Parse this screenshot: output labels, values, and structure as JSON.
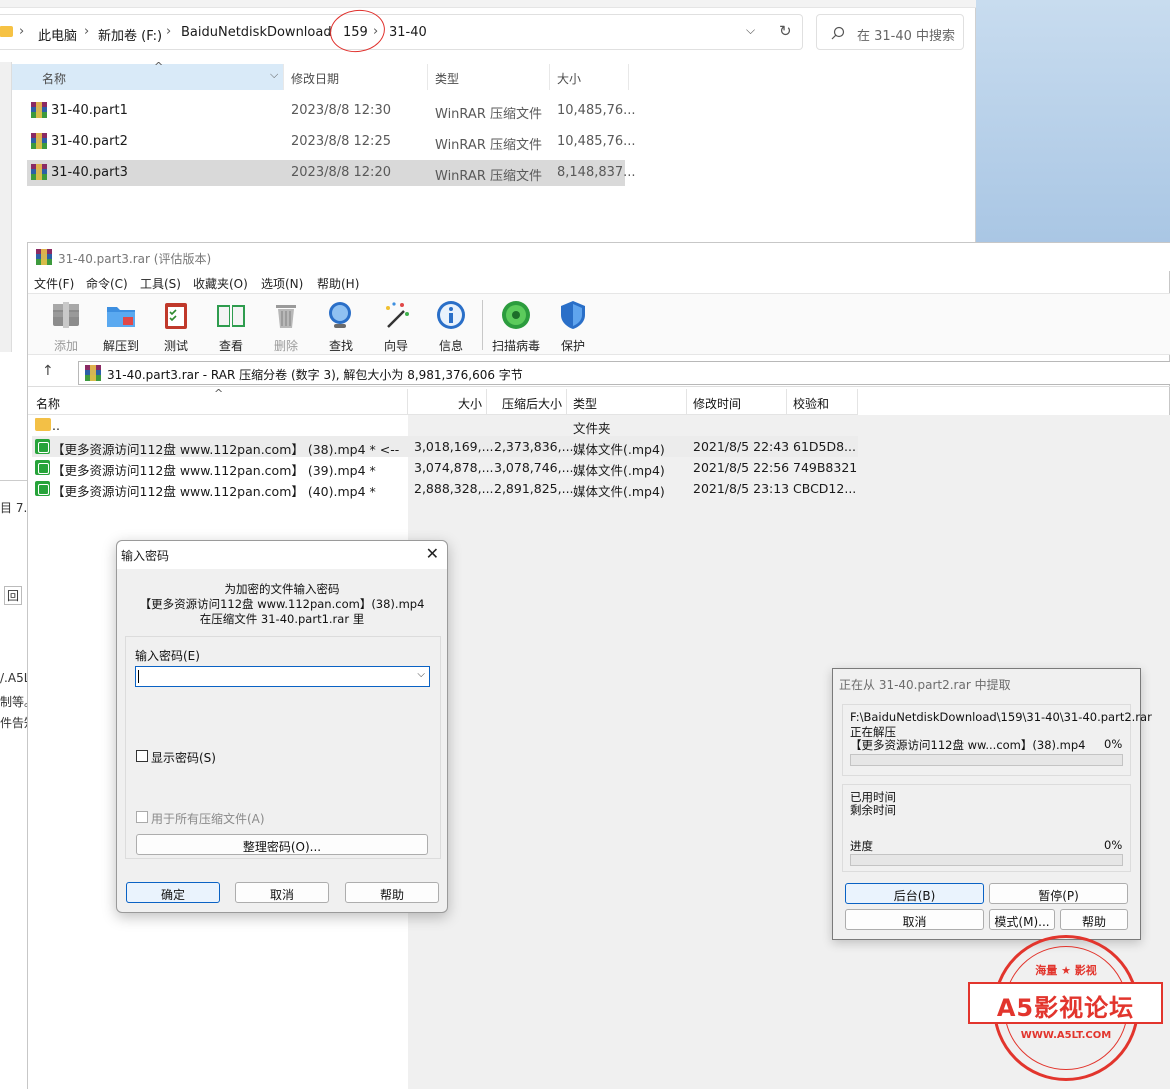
{
  "explorer": {
    "breadcrumb": [
      "此电脑",
      "新加卷 (F:)",
      "BaiduNetdiskDownload",
      "159",
      "31-40"
    ],
    "search_placeholder": "在 31-40 中搜索",
    "columns": [
      "名称",
      "修改日期",
      "类型",
      "大小"
    ],
    "files": [
      {
        "name": "31-40.part1",
        "date": "2023/8/8 12:30",
        "type": "WinRAR 压缩文件",
        "size": "10,485,76..."
      },
      {
        "name": "31-40.part2",
        "date": "2023/8/8 12:25",
        "type": "WinRAR 压缩文件",
        "size": "10,485,76..."
      },
      {
        "name": "31-40.part3",
        "date": "2023/8/8 12:20",
        "type": "WinRAR 压缩文件",
        "size": "8,148,837..."
      }
    ]
  },
  "winrar": {
    "title": "31-40.part3.rar (评估版本)",
    "menu": [
      "文件(F)",
      "命令(C)",
      "工具(S)",
      "收藏夹(O)",
      "选项(N)",
      "帮助(H)"
    ],
    "toolbar": [
      "添加",
      "解压到",
      "测试",
      "查看",
      "删除",
      "查找",
      "向导",
      "信息",
      "扫描病毒",
      "保护"
    ],
    "path_info": "31-40.part3.rar - RAR 压缩分卷 (数字 3), 解包大小为 8,981,376,606 字节",
    "columns": [
      "名称",
      "大小",
      "压缩后大小",
      "类型",
      "修改时间",
      "校验和"
    ],
    "parent": {
      "name": "..",
      "type": "文件夹"
    },
    "entries": [
      {
        "name": "【更多资源访问112盘 www.112pan.com】 (38).mp4 * <--",
        "size": "3,018,169,...",
        "packed": "2,373,836,...",
        "type": "媒体文件(.mp4)",
        "modified": "2021/8/5 22:43",
        "crc": "61D5D8..."
      },
      {
        "name": "【更多资源访问112盘 www.112pan.com】 (39).mp4 *",
        "size": "3,074,878,...",
        "packed": "3,078,746,...",
        "type": "媒体文件(.mp4)",
        "modified": "2021/8/5 22:56",
        "crc": "749B8321"
      },
      {
        "name": "【更多资源访问112盘 www.112pan.com】 (40).mp4 *",
        "size": "2,888,328,...",
        "packed": "2,891,825,...",
        "type": "媒体文件(.mp4)",
        "modified": "2021/8/5 23:13",
        "crc": "CBCD12..."
      }
    ]
  },
  "password_dialog": {
    "title": "输入密码",
    "line1": "为加密的文件输入密码",
    "line2": "【更多资源访问112盘 www.112pan.com】(38).mp4",
    "line3": "在压缩文件 31-40.part1.rar 里",
    "field_label": "输入密码(E)",
    "field_value": "",
    "show_password": "显示密码(S)",
    "use_for_all": "用于所有压缩文件(A)",
    "organize": "整理密码(O)...",
    "ok": "确定",
    "cancel": "取消",
    "help": "帮助"
  },
  "extract_dialog": {
    "title": "正在从 31-40.part2.rar 中提取",
    "path": "F:\\BaiduNetdiskDownload\\159\\31-40\\31-40.part2.rar",
    "status": "正在解压",
    "file": "【更多资源访问112盘 ww...com】(38).mp4",
    "file_percent": "0%",
    "elapsed_label": "已用时间",
    "remaining_label": "剩余时间",
    "progress_label": "进度",
    "progress_percent": "0%",
    "file_progress": 0,
    "total_progress": 0,
    "background": "后台(B)",
    "pause": "暂停(P)",
    "cancel": "取消",
    "mode": "模式(M)...",
    "help": "帮助"
  },
  "behind_fragments": [
    "目 7.",
    "回",
    "/.A5L",
    "制等。",
    "件告知"
  ],
  "watermark": {
    "top": "海量 ★ 影视",
    "main": "A5影视论坛",
    "url": "WWW.A5LT.COM"
  },
  "colors": {
    "accent": "#0a62c4",
    "stamp": "#e2352d",
    "annotation": "#e0302c"
  }
}
